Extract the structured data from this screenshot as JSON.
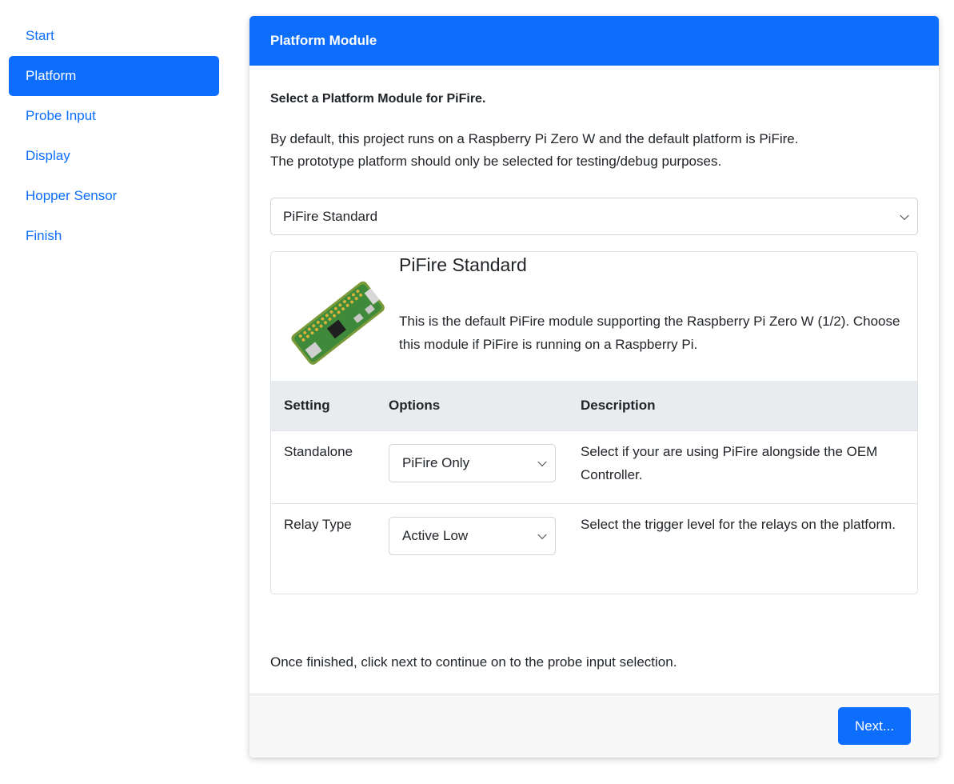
{
  "sidebar": {
    "items": [
      {
        "label": "Start"
      },
      {
        "label": "Platform"
      },
      {
        "label": "Probe Input"
      },
      {
        "label": "Display"
      },
      {
        "label": "Hopper Sensor"
      },
      {
        "label": "Finish"
      }
    ],
    "active_index": 1
  },
  "card": {
    "header_title": "Platform Module",
    "intro_title": "Select a Platform Module for PiFire.",
    "intro_desc_line1": "By default, this project runs on a Raspberry Pi Zero W and the default platform is PiFire.",
    "intro_desc_line2": "The prototype platform should only be selected for testing/debug purposes.",
    "platform_select_value": "PiFire Standard",
    "module": {
      "name": "PiFire Standard",
      "description": "This is the default PiFire module supporting the Raspberry Pi Zero W (1/2). Choose this module if PiFire is running on a Raspberry Pi.",
      "image_icon": "raspberry-pi-zero-board"
    },
    "table": {
      "headers": [
        "Setting",
        "Options",
        "Description"
      ],
      "rows": [
        {
          "setting": "Standalone",
          "option": "PiFire Only",
          "description": "Select if your are using PiFire alongside the OEM Controller."
        },
        {
          "setting": "Relay Type",
          "option": "Active Low",
          "description": "Select the trigger level for the relays on the platform."
        }
      ]
    },
    "finish_note": "Once finished, click next to continue on to the probe input selection.",
    "next_label": "Next..."
  },
  "colors": {
    "primary": "#0d6efd",
    "table_header_bg": "#e9ecef",
    "footer_bg": "#f7f7f7"
  }
}
